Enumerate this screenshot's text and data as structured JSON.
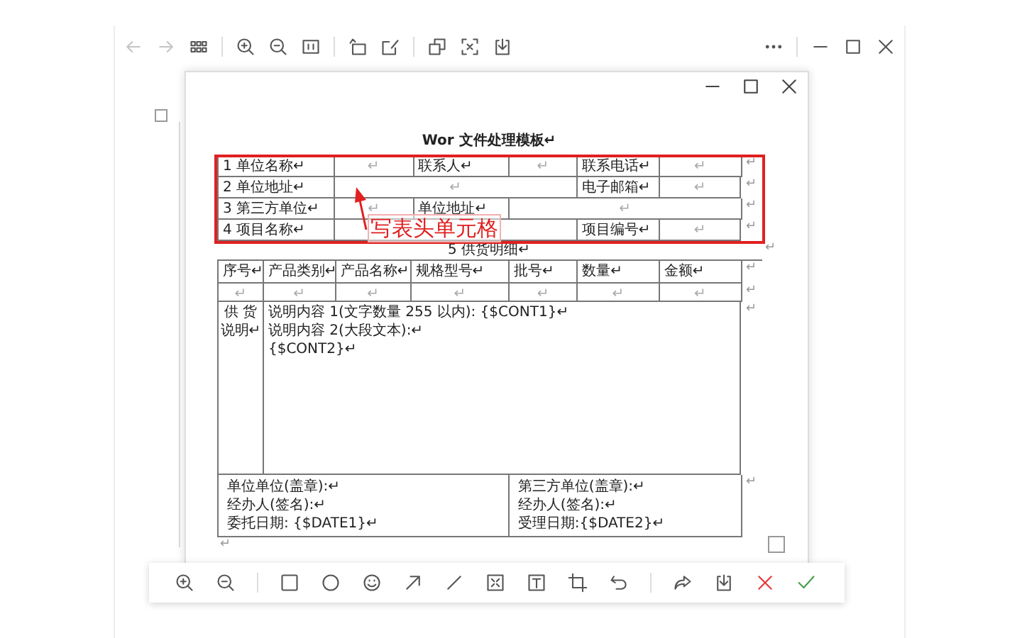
{
  "document": {
    "title": "Wor 文件处理模板↵",
    "header_table": {
      "rows": [
        {
          "cells": [
            "1 单位名称↵",
            "↵",
            "联系人↵",
            "↵",
            "联系电话↵",
            "↵"
          ],
          "row_end": "↵"
        },
        {
          "cells": [
            "2 单位地址↵",
            "",
            "↵",
            "",
            "电子邮箱↵",
            "↵"
          ],
          "row_end": "↵"
        },
        {
          "cells": [
            "3 第三方单位↵",
            "↵",
            "单位地址↵",
            "",
            "↵",
            ""
          ],
          "row_end": "↵"
        },
        {
          "cells": [
            "4 项目名称↵",
            "",
            "",
            "",
            "项目编号↵",
            "↵"
          ],
          "row_end": "↵"
        }
      ]
    },
    "section_title": "5 供货明细↵",
    "section_end": "↵",
    "detail_table": {
      "columns": [
        "序号↵",
        "产品类别↵",
        "产品名称↵",
        "规格型号↵",
        "批号↵",
        "数量↵",
        "金额↵"
      ],
      "header_end": "↵",
      "rows": [
        {
          "cells": [
            "↵",
            "↵",
            "↵",
            "↵",
            "↵",
            "↵",
            "↵"
          ],
          "row_end": "↵"
        }
      ],
      "description": {
        "label": [
          "供 货",
          "说明↵"
        ],
        "lines": [
          "说明内容 1(文字数量 255 以内): {$CONT1}↵",
          "说明内容 2(大段文本):↵",
          "{$CONT2}↵"
        ],
        "row_end": "↵"
      }
    },
    "signature_table": {
      "left": [
        "单位单位(盖章):↵",
        "经办人(签名):↵",
        "委托日期: {$DATE1}↵"
      ],
      "right": [
        "第三方单位(盖章):↵",
        "经办人(签名):↵",
        "受理日期:{$DATE2}↵"
      ],
      "row_end": "↵"
    },
    "trailing_mark": "↵"
  },
  "annotation": {
    "text": "写表头单元格"
  }
}
